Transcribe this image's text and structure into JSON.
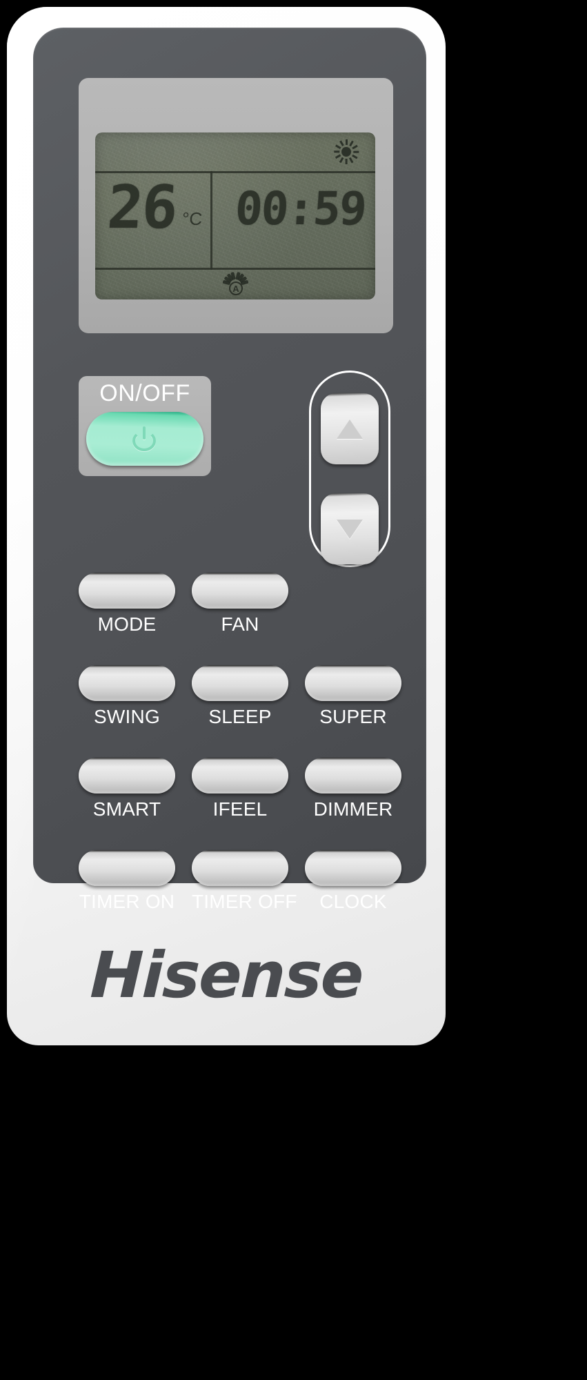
{
  "device": {
    "brand": "Hisense",
    "type": "air-conditioner-remote"
  },
  "display": {
    "temperature": "26",
    "temperature_unit": "°C",
    "clock": "00:59",
    "sun_icon": "sun-icon",
    "fan_auto_icon": "fan-auto-icon",
    "fan_auto_letter": "A",
    "lcd_color": "#69705f",
    "segment_color": "#262b23"
  },
  "power": {
    "label": "ON/OFF",
    "icon": "power-icon",
    "button_color": "#a5ecd2"
  },
  "temp_arrows": {
    "up_icon": "triangle-up-icon",
    "up_name": "temperature-up",
    "down_icon": "triangle-down-icon",
    "down_name": "temperature-down"
  },
  "buttons": [
    [
      {
        "label": "MODE",
        "name": "mode"
      },
      {
        "label": "FAN",
        "name": "fan"
      },
      {
        "label": "",
        "name": "empty"
      }
    ],
    [
      {
        "label": "SWING",
        "name": "swing"
      },
      {
        "label": "SLEEP",
        "name": "sleep"
      },
      {
        "label": "SUPER",
        "name": "super"
      }
    ],
    [
      {
        "label": "SMART",
        "name": "smart"
      },
      {
        "label": "IFEEL",
        "name": "ifeel"
      },
      {
        "label": "DIMMER",
        "name": "dimmer"
      }
    ],
    [
      {
        "label": "TIMER ON",
        "name": "timer-on"
      },
      {
        "label": "TIMER OFF",
        "name": "timer-off"
      },
      {
        "label": "CLOCK",
        "name": "clock"
      }
    ]
  ],
  "colors": {
    "shell": "#ffffff",
    "faceplate": "#54565a",
    "bezel": "#b4b4b4",
    "button": "#dedede",
    "accent_green": "#a5ecd2",
    "brand_text": "#4a4c50"
  }
}
